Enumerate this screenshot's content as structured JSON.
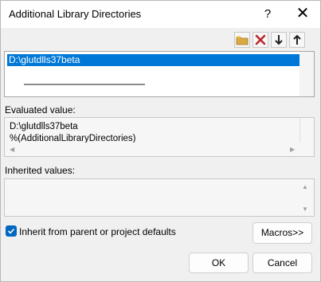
{
  "window": {
    "title": "Additional Library Directories",
    "help_glyph": "?",
    "close_glyph": "✕"
  },
  "toolbar": {
    "buttons": [
      {
        "name": "new-line-icon"
      },
      {
        "name": "delete-icon",
        "color": "#c0262c"
      },
      {
        "name": "move-down-icon"
      },
      {
        "name": "move-up-icon"
      }
    ]
  },
  "list": {
    "items": [
      "D:\\glutdlls37beta"
    ]
  },
  "evaluated": {
    "label": "Evaluated value:",
    "lines": [
      "D:\\glutdlls37beta",
      "%(AdditionalLibraryDirectories)"
    ]
  },
  "inherited": {
    "label": "Inherited values:"
  },
  "inherit_checkbox": {
    "label": "Inherit from parent or project defaults",
    "checked": true
  },
  "buttons": {
    "macros": "Macros>>",
    "ok": "OK",
    "cancel": "Cancel"
  },
  "colors": {
    "selection": "#0078d7",
    "checkbox": "#0067c0"
  }
}
